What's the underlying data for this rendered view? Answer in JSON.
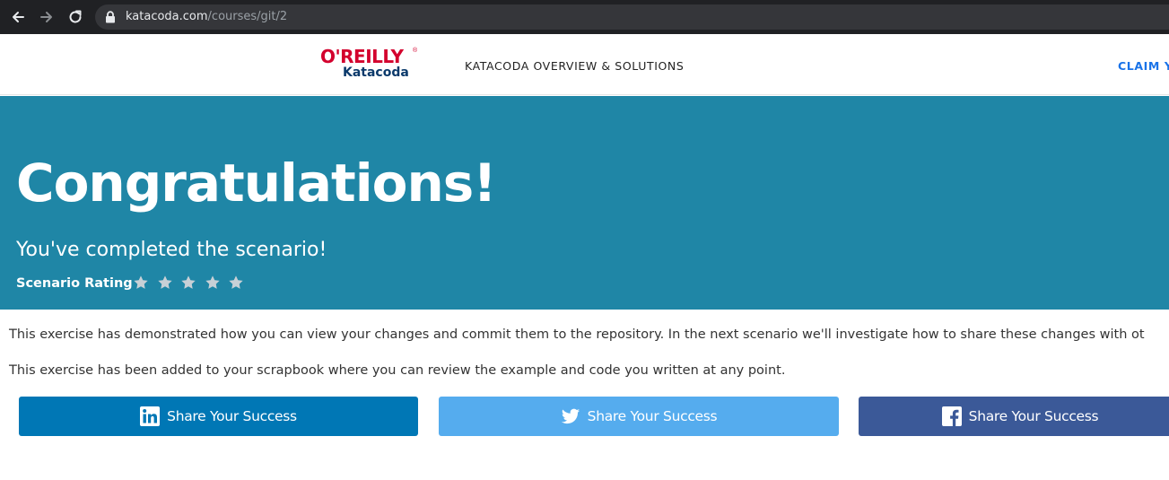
{
  "browser": {
    "url_host": "katacoda.com",
    "url_path": "/courses/git/2"
  },
  "header": {
    "logo_top": "O'REILLY",
    "logo_registered": "®",
    "logo_bottom": "Katacoda",
    "nav_link": "KATACODA OVERVIEW & SOLUTIONS",
    "claim_link": "CLAIM Y"
  },
  "hero": {
    "title": "Congratulations!",
    "subtitle": "You've completed the scenario!",
    "rating_label": "Scenario Rating",
    "stars_total": 5,
    "star_color": "#c8d0d6"
  },
  "content": {
    "paragraph_1": "This exercise has demonstrated how you can view your changes and commit them to the repository. In the next scenario we'll investigate how to share these changes with ot",
    "paragraph_2": "This exercise has been added to your scrapbook where you can review the example and code you written at any point."
  },
  "share_buttons": [
    {
      "network": "linkedin",
      "icon": "linkedin-icon",
      "label": "Share Your Success",
      "color": "#0077b5"
    },
    {
      "network": "twitter",
      "icon": "twitter-icon",
      "label": "Share Your Success",
      "color": "#55acee"
    },
    {
      "network": "facebook",
      "icon": "facebook-icon",
      "label": "Share Your Success",
      "color": "#3b5998"
    }
  ],
  "colors": {
    "hero_bg": "#1f86a6",
    "brand_red": "#d3002d",
    "brand_navy": "#0b3a6b",
    "link_blue": "#1a73e8"
  }
}
